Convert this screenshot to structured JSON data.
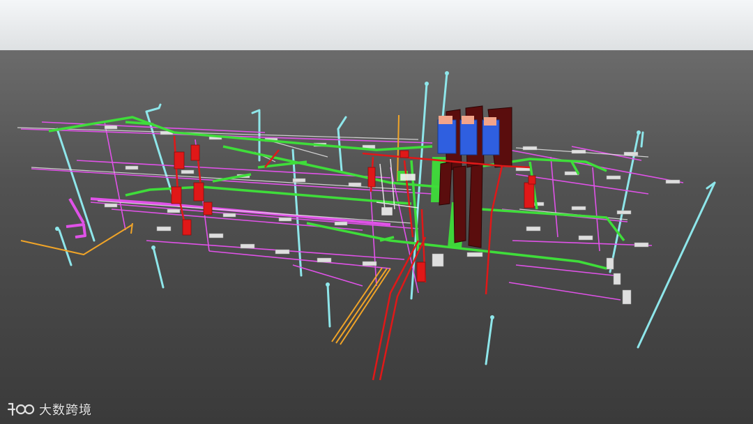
{
  "watermark": {
    "text": "大数跨境"
  },
  "colors": {
    "sky_top": "#f3f5f7",
    "sky_bottom": "#d9dcde",
    "ground_horizon": "#6a6a6a",
    "ground_near": "#3b3b3b",
    "pipe_green": "#3fdd3a",
    "pipe_magenta": "#e052e8",
    "pipe_red": "#e01818",
    "pipe_dark_red": "#5a0d0d",
    "pipe_cyan": "#8ee6ea",
    "pipe_orange": "#f0a428",
    "pipe_white": "#e6e6e6",
    "equipment_blue": "#2f5fe0",
    "equipment_peach": "#f2a48a"
  }
}
